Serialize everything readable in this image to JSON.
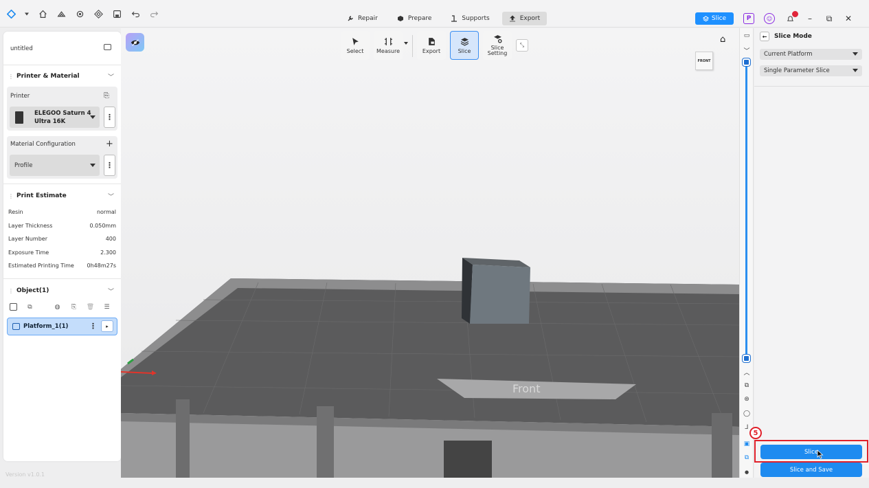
{
  "topbar": {
    "tabs": [
      {
        "label": "Repair",
        "icon": "wrench-icon",
        "active": false
      },
      {
        "label": "Prepare",
        "icon": "hexagon-icon",
        "active": false
      },
      {
        "label": "Supports",
        "icon": "support-icon",
        "active": false
      },
      {
        "label": "Export",
        "icon": "upload-icon",
        "active": true
      }
    ],
    "slice_label": "Slice",
    "p_badge": "P",
    "notification_count": "1"
  },
  "left_panel": {
    "file_name": "untitled",
    "printer_material": {
      "title": "Printer & Material",
      "printer_label": "Printer",
      "printer_name_line1": "ELEGOO Saturn 4",
      "printer_name_line2": "Ultra 16K",
      "material_label": "Material Configuration",
      "profile_value": "Profile"
    },
    "estimate": {
      "title": "Print Estimate",
      "rows": [
        {
          "label": "Resin",
          "value": "normal"
        },
        {
          "label": "Layer Thickness",
          "value": "0.050mm"
        },
        {
          "label": "Layer Number",
          "value": "400"
        },
        {
          "label": "Exposure Time",
          "value": "2.300"
        },
        {
          "label": "Estimated Printing Time",
          "value": "0h48m27s"
        }
      ]
    },
    "objects": {
      "title": "Object(1)",
      "platform_label": "Platform_1(1)"
    },
    "version": "Version v1.0.1"
  },
  "viewport": {
    "tools": [
      {
        "label": "Select",
        "icon": "cursor-icon"
      },
      {
        "label": "Measure",
        "icon": "ruler-icon"
      },
      {
        "label": "Export",
        "icon": "export-file-icon"
      },
      {
        "label": "Slice",
        "icon": "layers-icon"
      },
      {
        "label": "Slice Setting",
        "icon": "slice-setting-icon"
      }
    ],
    "cube_face": "FRONT",
    "platform_text": "Front"
  },
  "right_panel": {
    "title": "Slice Mode",
    "platform_select": "Current Platform",
    "mode_select": "Single Parameter Slice",
    "slice_button": "Slice",
    "slice_save_button": "Slice and Save",
    "step_number": "5"
  },
  "colors": {
    "accent": "#1e8bf0",
    "highlight": "#e0202a",
    "brand_purple": "#8a2be2"
  }
}
